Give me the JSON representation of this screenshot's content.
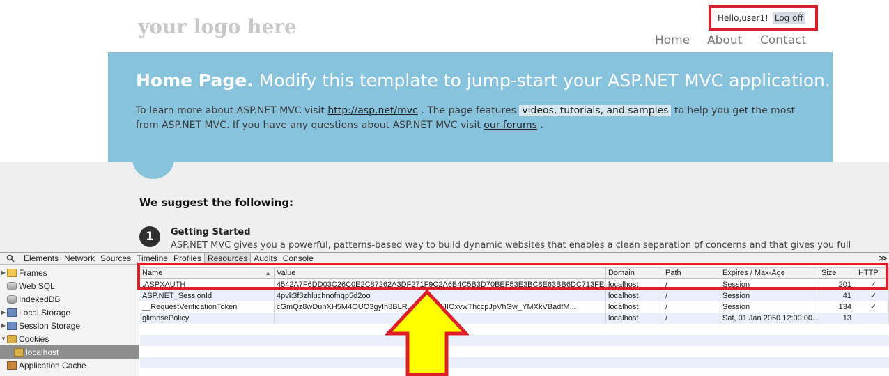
{
  "site": {
    "logo": "your logo here",
    "login": {
      "hello": "Hello, ",
      "user": "user1",
      "bang": "!",
      "logoff": "Log off"
    },
    "nav": [
      "Home",
      "About",
      "Contact"
    ],
    "hero": {
      "title_bold": "Home Page.",
      "title_rest": " Modify this template to jump-start your ASP.NET MVC application.",
      "p1": "To learn more about ASP.NET MVC visit ",
      "link1": "http://asp.net/mvc",
      "p2": " . The page features ",
      "highlight": "videos, tutorials, and samples",
      "p3": " to help you get the most from ASP.NET MVC. If you have any questions about ASP.NET MVC visit ",
      "link2": "our forums",
      "p4": " ."
    },
    "suggest": "We suggest the following:",
    "step": {
      "number": "1",
      "title": "Getting Started",
      "text": "ASP.NET MVC gives you a powerful, patterns-based way to build dynamic websites that enables a clean separation of concerns and that gives you full"
    }
  },
  "devtools": {
    "tabs": [
      "Elements",
      "Network",
      "Sources",
      "Timeline",
      "Profiles",
      "Resources",
      "Audits",
      "Console"
    ],
    "active_tab": "Resources",
    "sidebar": [
      {
        "label": "Frames",
        "icon": "folder-icon",
        "expandable": true
      },
      {
        "label": "Web SQL",
        "icon": "database-icon",
        "expandable": false
      },
      {
        "label": "IndexedDB",
        "icon": "database-icon",
        "expandable": false
      },
      {
        "label": "Local Storage",
        "icon": "storage-grid-icon",
        "expandable": true
      },
      {
        "label": "Session Storage",
        "icon": "storage-grid-icon",
        "expandable": true
      },
      {
        "label": "Cookies",
        "icon": "cookie-icon",
        "expandable": true,
        "expanded": true
      },
      {
        "label": "localhost",
        "icon": "cookie-icon",
        "selected": true
      },
      {
        "label": "Application Cache",
        "icon": "cache-icon",
        "expandable": false
      }
    ],
    "columns": [
      "Name",
      "Value",
      "Domain",
      "Path",
      "Expires / Max-Age",
      "Size",
      "HTTP"
    ],
    "cookies": [
      {
        "name": ".ASPXAUTH",
        "value": "4542A7F6DD03C26C0E2C87262A3DF271F9C2A6B4C5B3D70BEF53E3BC8E63BB6DC713FE5...",
        "domain": "localhost",
        "path": "/",
        "expires": "Session",
        "size": "201",
        "http": "✓"
      },
      {
        "name": "ASP.NET_SessionId",
        "value": "4pvk3f3zhluchnofnqp5d2oo",
        "domain": "localhost",
        "path": "/",
        "expires": "Session",
        "size": "41",
        "http": "✓"
      },
      {
        "name": "__RequestVerificationToken",
        "value": "cGmQz8wDunXH5M4OUO3gyIh8BLR...RjWG73JIOxvwThccpJpVhGw_YMXkVBadfM...",
        "domain": "localhost",
        "path": "/",
        "expires": "Session",
        "size": "134",
        "http": "✓"
      },
      {
        "name": "glimpsePolicy",
        "value": "",
        "domain": "localhost",
        "path": "/",
        "expires": "Sat, 01 Jan 2050 12:00:00...",
        "size": "13",
        "http": ""
      }
    ]
  },
  "colors": {
    "annotation_red": "#dd1f2a",
    "arrow_yellow": "#ffff00",
    "hero_blue": "#88c3dd"
  }
}
